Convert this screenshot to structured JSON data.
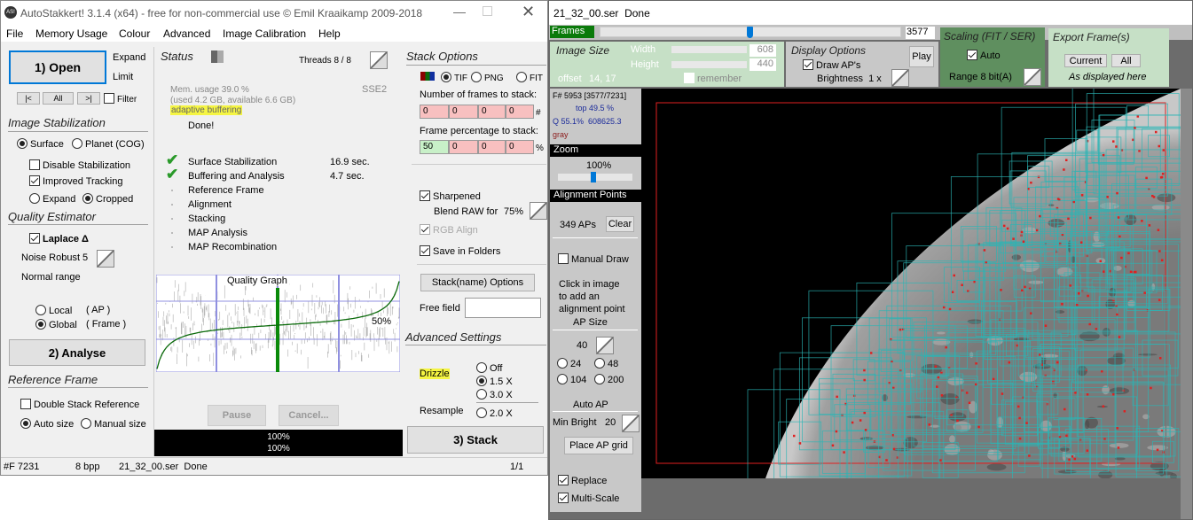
{
  "left_window": {
    "title": "AutoStakkert! 3.1.4 (x64) - free for non-commercial use © Emil Kraaikamp 2009-2018",
    "logo": "AS!",
    "menu": [
      "File",
      "Memory Usage",
      "Colour",
      "Advanced",
      "Image Calibration",
      "Help"
    ],
    "open_label": "1) Open",
    "expand": "Expand",
    "limit": "Limit",
    "nav": [
      "|<",
      "All",
      ">|"
    ],
    "filter": "Filter",
    "image_stabilization": {
      "heading": "Image Stabilization",
      "surface": "Surface",
      "planet": "Planet (COG)",
      "disable": "Disable Stabilization",
      "improved": "Improved Tracking",
      "expand": "Expand",
      "cropped": "Cropped"
    },
    "quality_estimator": {
      "heading": "Quality Estimator",
      "laplace": "Laplace Δ",
      "noise_robust": "Noise Robust",
      "noise_value": "5",
      "normal_range": "Normal range",
      "local": "Local",
      "local_ap": "( AP )",
      "global": "Global",
      "global_frame": "( Frame )"
    },
    "analyse_label": "2) Analyse",
    "reference_frame": {
      "heading": "Reference Frame",
      "double": "Double Stack Reference",
      "auto": "Auto size",
      "manual": "Manual size"
    },
    "status": {
      "heading": "Status",
      "threads": "Threads 8 / 8",
      "sse": "SSE2",
      "mem1": "Mem. usage 39.0 %",
      "mem2": "(used 4.2 GB, available 6.6 GB)",
      "buffering": "adaptive buffering",
      "done": "Done!",
      "steps": [
        {
          "label": "Surface Stabilization",
          "time": "16.9 sec.",
          "done": true
        },
        {
          "label": "Buffering and Analysis",
          "time": "4.7 sec.",
          "done": true
        },
        {
          "label": "Reference Frame",
          "time": "",
          "done": false
        },
        {
          "label": "Alignment",
          "time": "",
          "done": false
        },
        {
          "label": "Stacking",
          "time": "",
          "done": false
        },
        {
          "label": "MAP Analysis",
          "time": "",
          "done": false
        },
        {
          "label": "MAP Recombination",
          "time": "",
          "done": false
        }
      ],
      "graph_title": "Quality Graph",
      "graph_pct": "50%",
      "pause": "Pause",
      "cancel": "Cancel...",
      "progress1": "100%",
      "progress2": "100%"
    },
    "stack_options": {
      "heading": "Stack Options",
      "tif": "TIF",
      "png": "PNG",
      "fit": "FIT",
      "frames_label": "Number of frames to stack:",
      "frames": [
        "0",
        "0",
        "0",
        "0"
      ],
      "hash": "#",
      "pct_label": "Frame percentage to stack:",
      "pcts": [
        "50",
        "0",
        "0",
        "0"
      ],
      "pct_sign": "%",
      "sharpened": "Sharpened",
      "blend": "Blend RAW for",
      "blend_value": "75%",
      "rgb_align": "RGB Align",
      "save_folders": "Save in Folders",
      "stackname": "Stack(name) Options",
      "free_field": "Free field",
      "free_value": ""
    },
    "advanced": {
      "heading": "Advanced Settings",
      "drizzle": "Drizzle",
      "off": "Off",
      "x15": "1.5 X",
      "x30": "3.0 X",
      "resample": "Resample",
      "x20": "2.0 X"
    },
    "stack_label": "3) Stack",
    "statusbar": [
      "#F 7231",
      "8 bpp",
      "21_32_00.ser  Done",
      "1/1"
    ]
  },
  "right_window": {
    "title": "21_32_00.ser  Done",
    "frames_label": "Frames",
    "frame_value": "3577",
    "frame_position": 0.495,
    "image_size": {
      "heading": "Image Size",
      "width_label": "Width",
      "width": "608",
      "height_label": "Height",
      "height": "440",
      "offset_label": "offset",
      "offset": "14, 17",
      "remember": "remember"
    },
    "display": {
      "heading": "Display Options",
      "play": "Play",
      "draw_aps": "Draw AP's",
      "brightness": "Brightness  1 x"
    },
    "scaling": {
      "heading": "Scaling (FIT / SER)",
      "auto": "Auto",
      "range": "Range 8 bit(A)"
    },
    "export": {
      "heading": "Export Frame(s)",
      "current": "Current",
      "all": "All",
      "note": "As displayed here"
    },
    "info": {
      "frame": "F# 5953 [3577/7231]",
      "top": "top 49.5 %",
      "q": "Q 55.1%  608625.3",
      "mode": "gray"
    },
    "zoom": {
      "heading": "Zoom",
      "value": "100%"
    },
    "ap": {
      "heading": "Alignment Points",
      "count": "349 APs",
      "clear": "Clear",
      "manual": "Manual Draw",
      "hint1": "Click in image",
      "hint2": "to add an",
      "hint3": "alignment point",
      "size_heading": "AP Size",
      "size": "40",
      "s24": "24",
      "s48": "48",
      "s104": "104",
      "s200": "200",
      "auto_heading": "Auto AP",
      "min_bright": "Min Bright",
      "min_value": "20",
      "place": "Place AP grid",
      "replace": "Replace",
      "multiscale": "Multi-Scale"
    },
    "colors": {
      "ap_box": "#2bb5b5",
      "roi": "#e02020",
      "frames_bar": "#0a7a0a"
    }
  }
}
